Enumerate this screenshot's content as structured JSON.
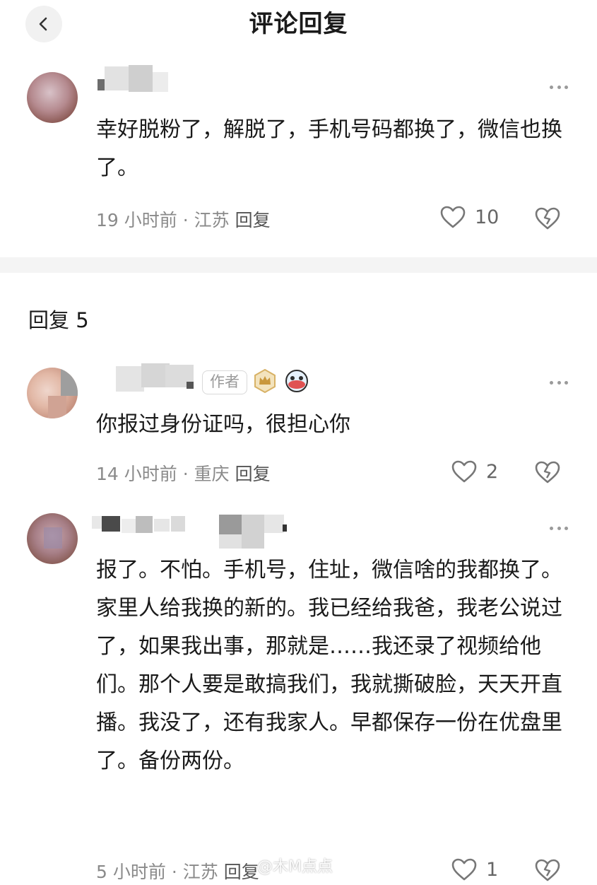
{
  "header": {
    "title": "评论回复"
  },
  "main_comment": {
    "text": "幸好脱粉了，解脱了，手机号码都换了，微信也换了。",
    "time": "19 小时前",
    "location": "江苏",
    "reply_label": "回复",
    "likes": "10"
  },
  "replies_header": {
    "label": "回复 5"
  },
  "replies": [
    {
      "badge": "作者",
      "text": "你报过身份证吗，很担心你",
      "time": "14 小时前",
      "location": "重庆",
      "reply_label": "回复",
      "likes": "2"
    },
    {
      "text": "报了。不怕。手机号，住址，微信啥的我都换了。家里人给我换的新的。我已经给我爸，我老公说过了，如果我出事，那就是……我还录了视频给他们。那个人要是敢搞我们，我就撕破脸，天天开直播。我没了，还有我家人。早都保存一份在优盘里了。备份两份。",
      "time": "5 小时前",
      "location": "江苏",
      "reply_label": "回复",
      "likes": "1"
    }
  ],
  "watermark": "@木M点点",
  "icons": [
    "back-icon",
    "more-icon",
    "heart-icon",
    "broken-heart-icon",
    "crown-badge-icon",
    "sticker-badge-icon"
  ],
  "colors": {
    "meta_text": "#8a8a8a",
    "divider": "#f4f4f4",
    "icon_gray": "#777777"
  }
}
